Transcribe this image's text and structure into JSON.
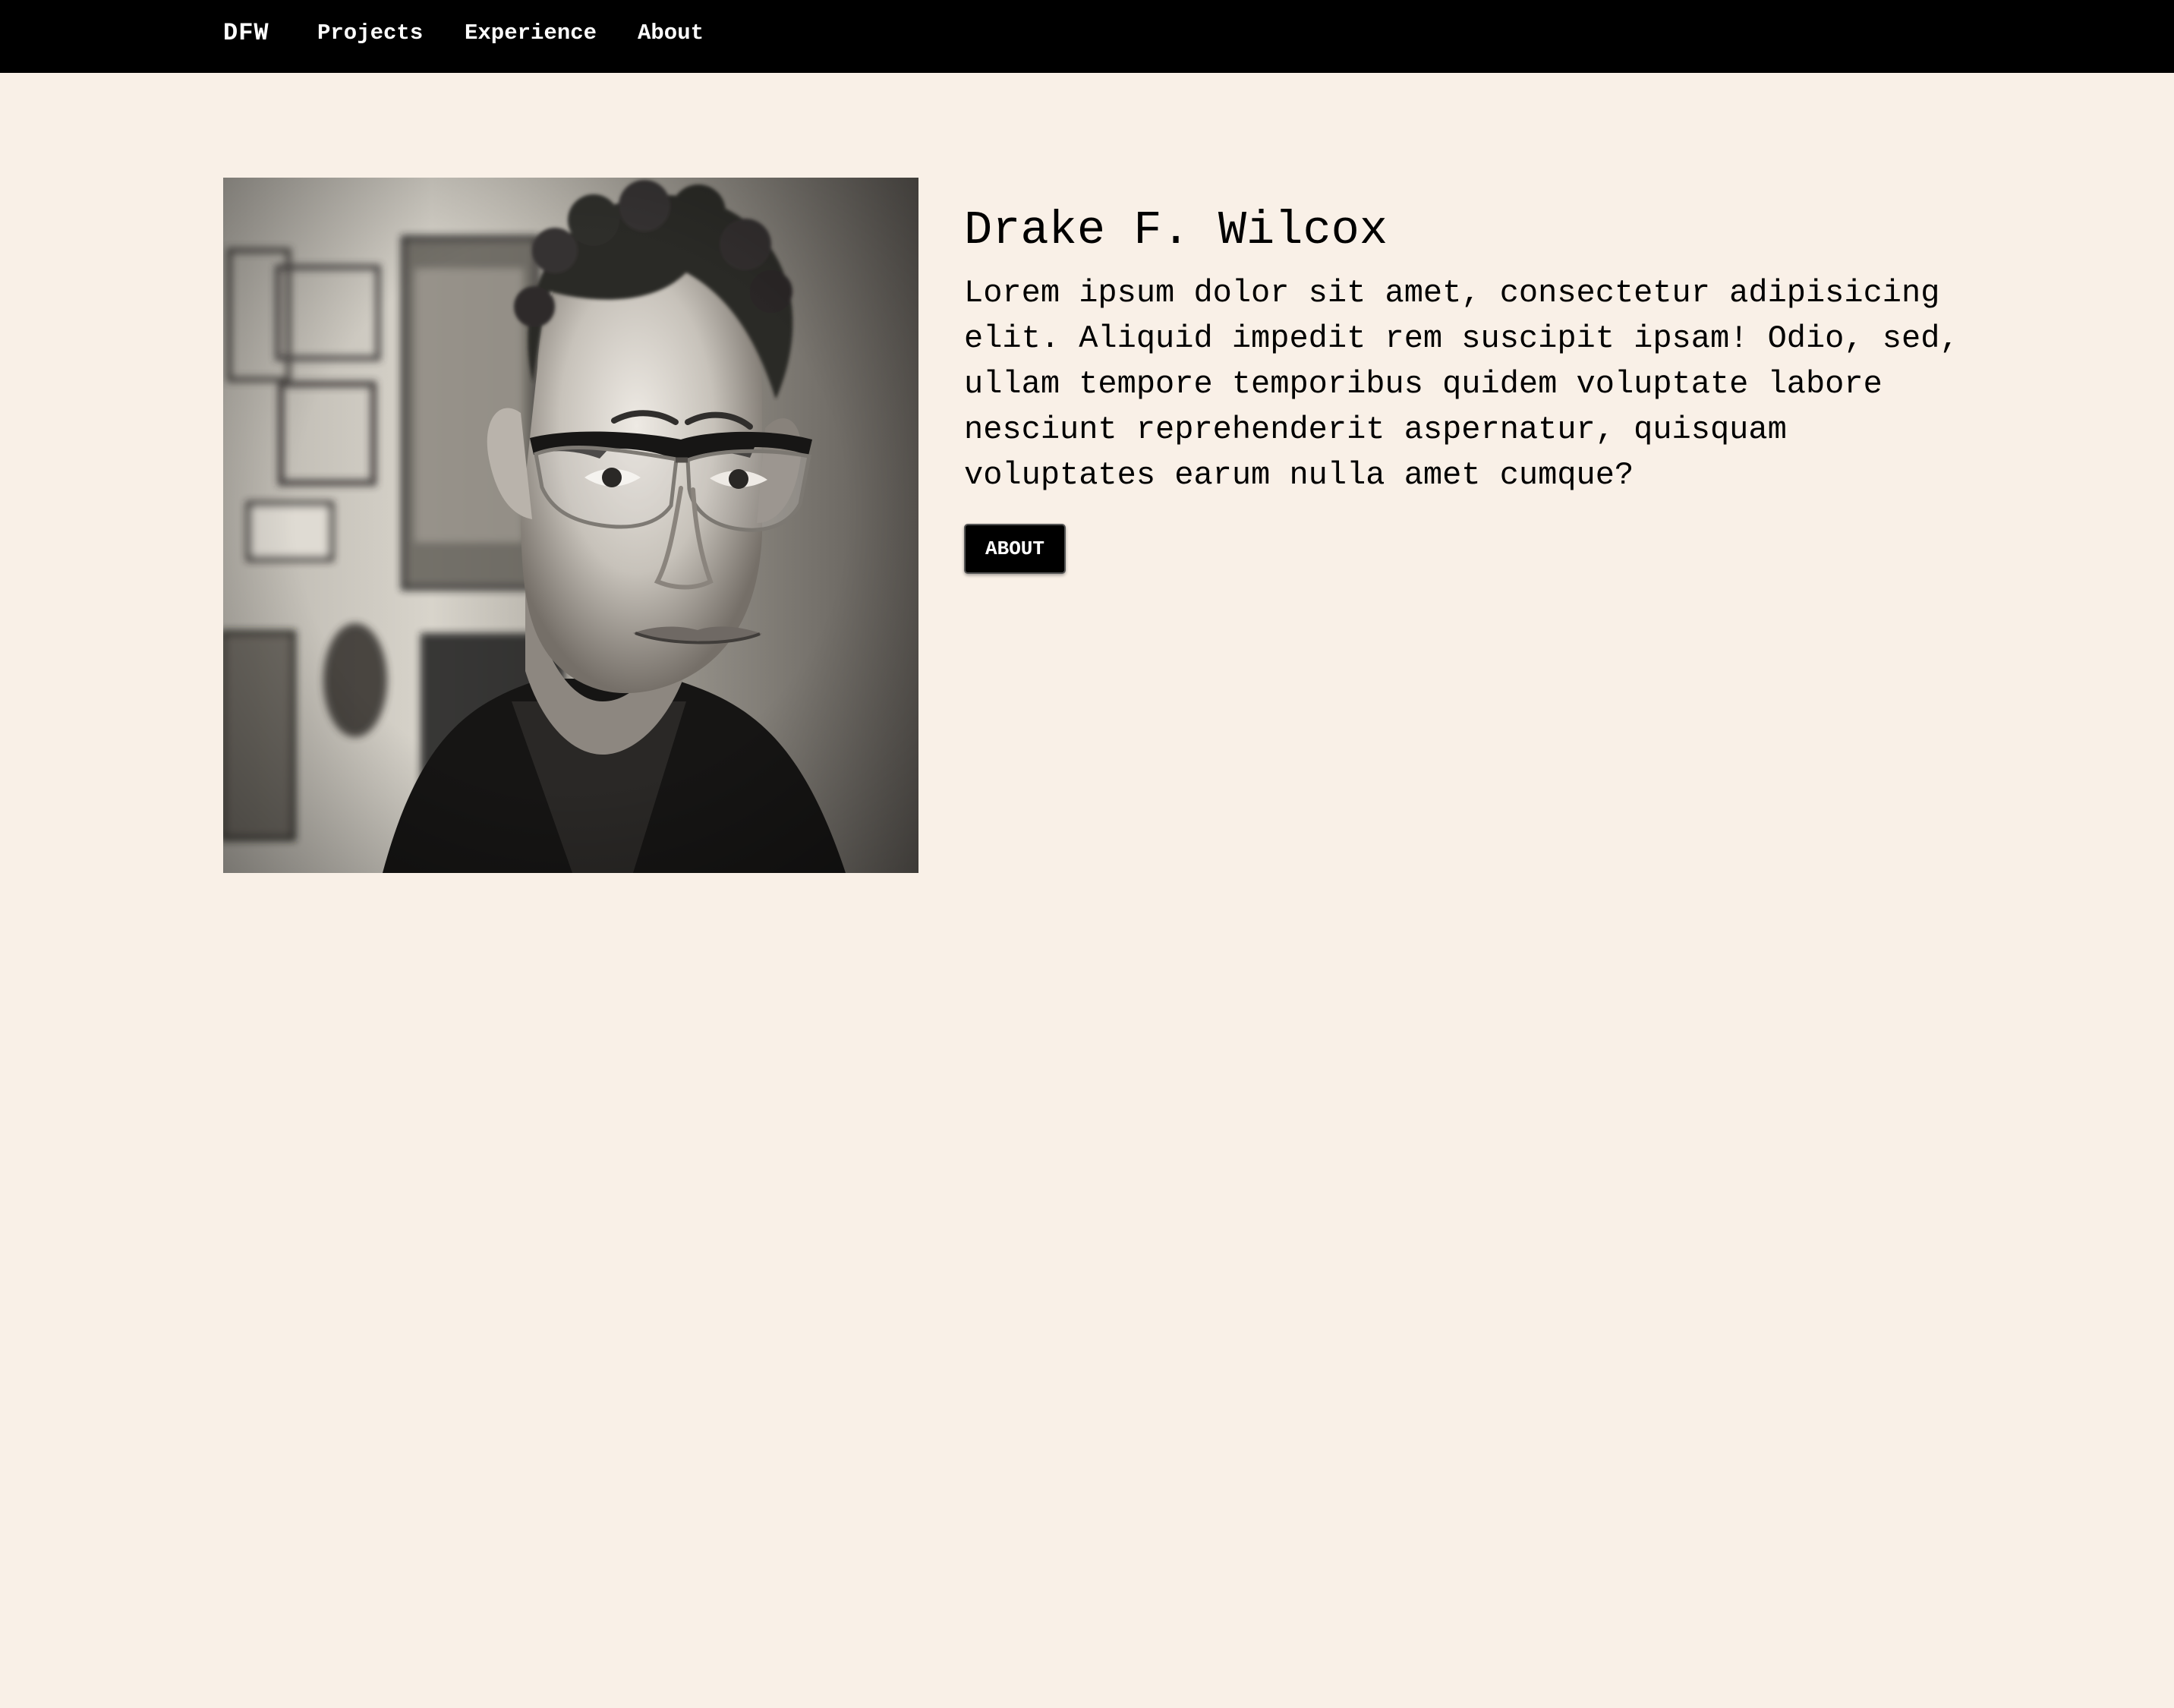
{
  "navbar": {
    "brand": "DFW",
    "links": [
      {
        "label": "Projects"
      },
      {
        "label": "Experience"
      },
      {
        "label": "About"
      }
    ]
  },
  "profile": {
    "photo_alt": "Portrait of Drake F. Wilcox",
    "name": "Drake F. Wilcox",
    "bio": "Lorem ipsum dolor sit amet, consectetur adipisicing elit. Aliquid impedit rem suscipit ipsam! Odio, sed, ullam tempore temporibus quidem voluptate labore nesciunt reprehenderit aspernatur, quisquam voluptates earum nulla amet cumque?",
    "button_label": "ABOUT"
  },
  "colors": {
    "navbar_background": "#000000",
    "page_background": "#f9f0e7",
    "button_background": "#000000"
  }
}
